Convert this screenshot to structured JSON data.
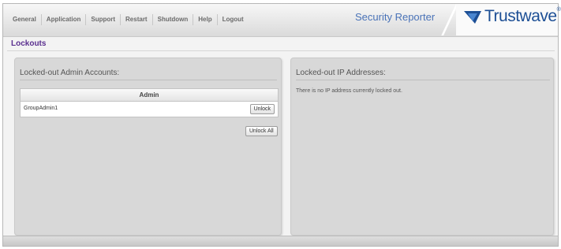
{
  "nav": {
    "items": [
      {
        "label": "General"
      },
      {
        "label": "Application"
      },
      {
        "label": "Support"
      },
      {
        "label": "Restart"
      },
      {
        "label": "Shutdown"
      },
      {
        "label": "Help"
      },
      {
        "label": "Logout"
      }
    ]
  },
  "header": {
    "app_title": "Security Reporter",
    "logo_text": "Trustwave",
    "logo_reg": "®"
  },
  "page": {
    "title": "Lockouts"
  },
  "admin_panel": {
    "heading": "Locked-out Admin Accounts:",
    "column_header": "Admin",
    "rows": [
      {
        "name": "GroupAdmin1",
        "action_label": "Unlock"
      }
    ],
    "unlock_all_label": "Unlock All"
  },
  "ip_panel": {
    "heading": "Locked-out IP Addresses:",
    "empty_message": "There is no IP address currently locked out."
  },
  "colors": {
    "page_title": "#5a2f8f",
    "app_title": "#4a73b8",
    "logo": "#1d4f95"
  }
}
